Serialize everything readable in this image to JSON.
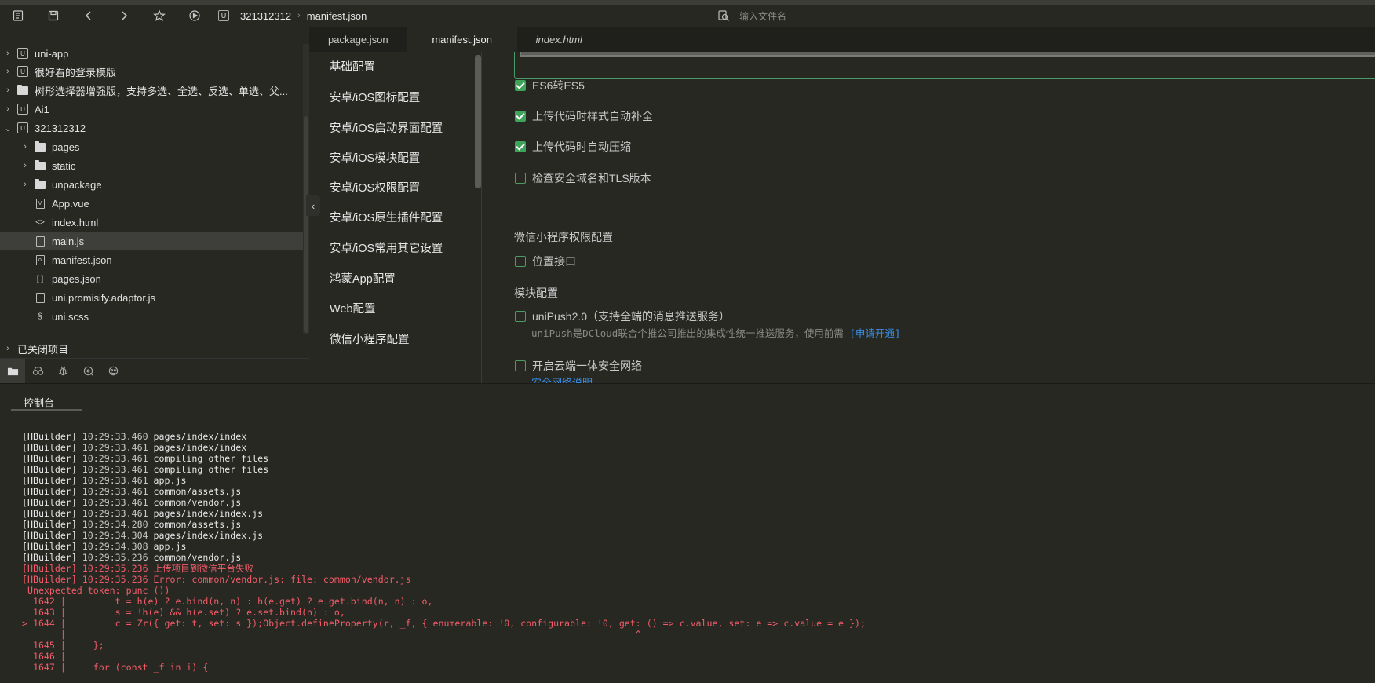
{
  "toolbar": {
    "icons": [
      "file-list-icon",
      "save-icon",
      "back-icon",
      "forward-icon",
      "star-icon",
      "run-icon"
    ],
    "breadcrumb": {
      "project_badge": "U",
      "project": "321312312",
      "file": "manifest.json"
    },
    "file_search_placeholder": "输入文件名"
  },
  "sidebar": {
    "tree": [
      {
        "label": "uni-app",
        "type": "project",
        "expanded": false,
        "level": 0
      },
      {
        "label": "很好看的登录模版",
        "type": "project",
        "expanded": false,
        "level": 0
      },
      {
        "label": "树形选择器增强版，支持多选、全选、反选、单选、父...",
        "type": "folder-project",
        "expanded": false,
        "level": 0
      },
      {
        "label": "Ai1",
        "type": "project",
        "expanded": false,
        "level": 0
      },
      {
        "label": "321312312",
        "type": "project",
        "expanded": true,
        "level": 0
      },
      {
        "label": "pages",
        "type": "folder",
        "expanded": false,
        "level": 1
      },
      {
        "label": "static",
        "type": "folder",
        "expanded": false,
        "level": 1
      },
      {
        "label": "unpackage",
        "type": "folder",
        "expanded": false,
        "level": 1
      },
      {
        "label": "App.vue",
        "type": "vue",
        "level": 1
      },
      {
        "label": "index.html",
        "type": "html",
        "level": 1
      },
      {
        "label": "main.js",
        "type": "js",
        "level": 1,
        "selected": true
      },
      {
        "label": "manifest.json",
        "type": "manifest",
        "level": 1
      },
      {
        "label": "pages.json",
        "type": "json",
        "level": 1
      },
      {
        "label": "uni.promisify.adaptor.js",
        "type": "js",
        "level": 1
      },
      {
        "label": "uni.scss",
        "type": "scss",
        "level": 1
      }
    ],
    "closed_projects": "已关闭项目",
    "bottom_icons": [
      "project-manager-icon",
      "binoculars-icon",
      "bug-icon",
      "git-icon",
      "plugin-icon"
    ]
  },
  "tabs": [
    {
      "label": "package.json",
      "active": false
    },
    {
      "label": "manifest.json",
      "active": true
    },
    {
      "label": "index.html",
      "active": false,
      "italic": true
    }
  ],
  "settings_nav": [
    "基础配置",
    "安卓/iOS图标配置",
    "安卓/iOS启动界面配置",
    "安卓/iOS模块配置",
    "安卓/iOS权限配置",
    "安卓/iOS原生插件配置",
    "安卓/iOS常用其它设置",
    "鸿蒙App配置",
    "Web配置",
    "微信小程序配置"
  ],
  "content": {
    "es6": {
      "label": "ES6转ES5",
      "checked": true
    },
    "auto_prefix": {
      "label": "上传代码时样式自动补全",
      "checked": true
    },
    "minify": {
      "label": "上传代码时自动压缩",
      "checked": true
    },
    "check_domain": {
      "label": "检查安全域名和TLS版本",
      "checked": false
    },
    "permission_title": "微信小程序权限配置",
    "location": {
      "label": "位置接口",
      "checked": false
    },
    "module_title": "模块配置",
    "unipush": {
      "label": "uniPush2.0（支持全端的消息推送服务）",
      "checked": false
    },
    "unipush_desc": "uniPush是DCloud联合个推公司推出的集成性统一推送服务，使用前需",
    "unipush_link": "[申请开通]",
    "secure_network": {
      "label": "开启云端一体安全网络",
      "checked": false
    },
    "secure_network_link": "安全网络说明"
  },
  "console": {
    "tab_label": "控制台",
    "lines": [
      {
        "tag": "[HBuilder]",
        "ts": "10:29:33.460",
        "msg": "pages/index/index",
        "error": false
      },
      {
        "tag": "[HBuilder]",
        "ts": "10:29:33.461",
        "msg": "pages/index/index",
        "error": false
      },
      {
        "tag": "[HBuilder]",
        "ts": "10:29:33.461",
        "msg": "compiling other files",
        "error": false
      },
      {
        "tag": "[HBuilder]",
        "ts": "10:29:33.461",
        "msg": "compiling other files",
        "error": false
      },
      {
        "tag": "[HBuilder]",
        "ts": "10:29:33.461",
        "msg": "app.js",
        "error": false
      },
      {
        "tag": "[HBuilder]",
        "ts": "10:29:33.461",
        "msg": "common/assets.js",
        "error": false
      },
      {
        "tag": "[HBuilder]",
        "ts": "10:29:33.461",
        "msg": "common/vendor.js",
        "error": false
      },
      {
        "tag": "[HBuilder]",
        "ts": "10:29:33.461",
        "msg": "pages/index/index.js",
        "error": false
      },
      {
        "tag": "[HBuilder]",
        "ts": "10:29:34.280",
        "msg": "common/assets.js",
        "error": false
      },
      {
        "tag": "[HBuilder]",
        "ts": "10:29:34.304",
        "msg": "pages/index/index.js",
        "error": false
      },
      {
        "tag": "[HBuilder]",
        "ts": "10:29:34.308",
        "msg": "app.js",
        "error": false
      },
      {
        "tag": "[HBuilder]",
        "ts": "10:29:35.236",
        "msg": "common/vendor.js",
        "error": false
      },
      {
        "tag": "[HBuilder]",
        "ts": "10:29:35.236",
        "msg": "上传项目到微信平台失败",
        "error": true
      },
      {
        "tag": "[HBuilder]",
        "ts": "10:29:35.236",
        "msg": "Error: common/vendor.js: file: common/vendor.js",
        "error": true
      },
      {
        "tag": "",
        "ts": "",
        "msg": " Unexpected token: punc ())",
        "error": true
      },
      {
        "tag": "",
        "ts": "",
        "msg": "  1642 |         t = h(e) ? e.bind(n, n) : h(e.get) ? e.get.bind(n, n) : o,",
        "error": true
      },
      {
        "tag": "",
        "ts": "",
        "msg": "  1643 |         s = !h(e) && h(e.set) ? e.set.bind(n) : o,",
        "error": true
      },
      {
        "tag": "",
        "ts": "",
        "msg": "> 1644 |         c = Zr({ get: t, set: s });Object.defineProperty(r, _f, { enumerable: !0, configurable: !0, get: () => c.value, set: e => c.value = e });",
        "error": true
      },
      {
        "tag": "",
        "ts": "",
        "msg": "       |                                                                                                        ^",
        "error": true
      },
      {
        "tag": "",
        "ts": "",
        "msg": "  1645 |     };",
        "error": true
      },
      {
        "tag": "",
        "ts": "",
        "msg": "  1646 |",
        "error": true
      },
      {
        "tag": "",
        "ts": "",
        "msg": "  1647 |     for (const _f in i) {",
        "error": true
      }
    ]
  }
}
